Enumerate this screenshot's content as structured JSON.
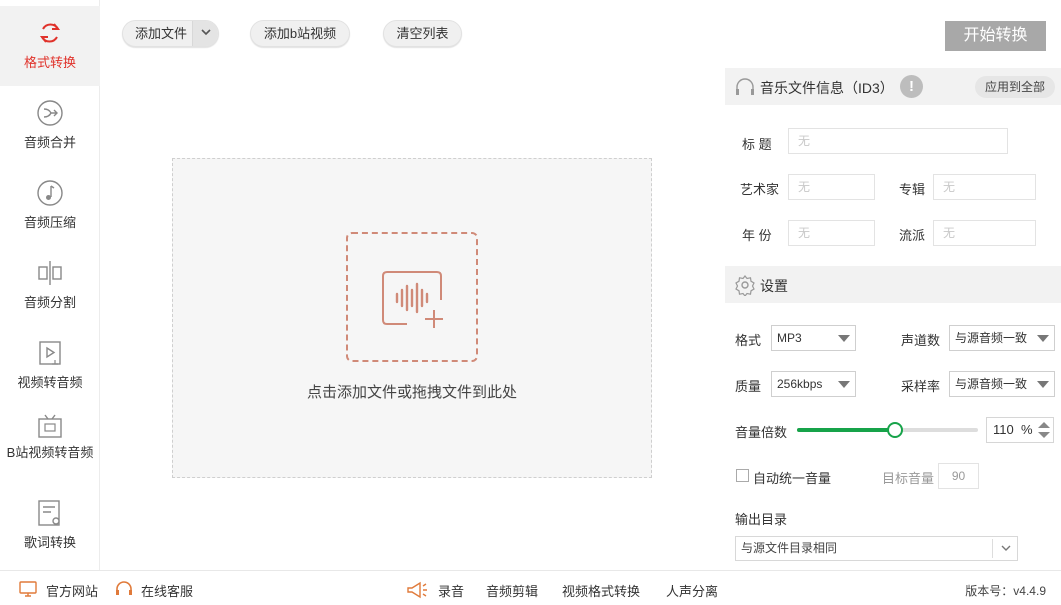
{
  "sidebar": {
    "items": [
      {
        "label": "格式转换",
        "icon": "format-convert-icon",
        "active": true
      },
      {
        "label": "音频合并",
        "icon": "audio-merge-icon"
      },
      {
        "label": "音频压缩",
        "icon": "audio-compress-icon"
      },
      {
        "label": "音频分割",
        "icon": "audio-split-icon"
      },
      {
        "label": "视频转音频",
        "icon": "video-to-audio-icon"
      },
      {
        "label": "B站视频转音频",
        "icon": "bilibili-icon"
      },
      {
        "label": "歌词转换",
        "icon": "lyrics-icon"
      }
    ]
  },
  "toolbar": {
    "add_file": "添加文件",
    "add_bili": "添加b站视频",
    "clear_list": "清空列表",
    "start": "开始转换"
  },
  "drop": {
    "text": "点击添加文件或拖拽文件到此处"
  },
  "id3": {
    "header": "音乐文件信息（ID3）",
    "info_icon": "!",
    "apply_all": "应用到全部",
    "title_label": "标  题",
    "artist_label": "艺术家",
    "album_label": "专辑",
    "year_label": "年  份",
    "genre_label": "流派",
    "placeholder": "无"
  },
  "settings": {
    "header": "设置",
    "format_label": "格式",
    "format_value": "MP3",
    "channels_label": "声道数",
    "channels_value": "与源音频一致",
    "quality_label": "质量",
    "quality_value": "256kbps",
    "samplerate_label": "采样率",
    "samplerate_value": "与源音频一致",
    "volume_label": "音量倍数",
    "volume_value": "110",
    "volume_unit": "%",
    "volume_fraction": 0.54,
    "auto_volume_label": "自动统一音量",
    "target_volume_label": "目标音量",
    "target_volume_value": "90",
    "output_label": "输出目录",
    "output_value": "与源文件目录相同"
  },
  "colors": {
    "accent": "#e0322b",
    "slider": "#17a34a",
    "drop_border": "#d08a78"
  },
  "bottom": {
    "website": "官方网站",
    "service": "在线客服",
    "record": "录音",
    "audio_edit": "音频剪辑",
    "video_convert": "视频格式转换",
    "vocal_sep": "人声分离",
    "version": "版本号：v4.4.9"
  }
}
